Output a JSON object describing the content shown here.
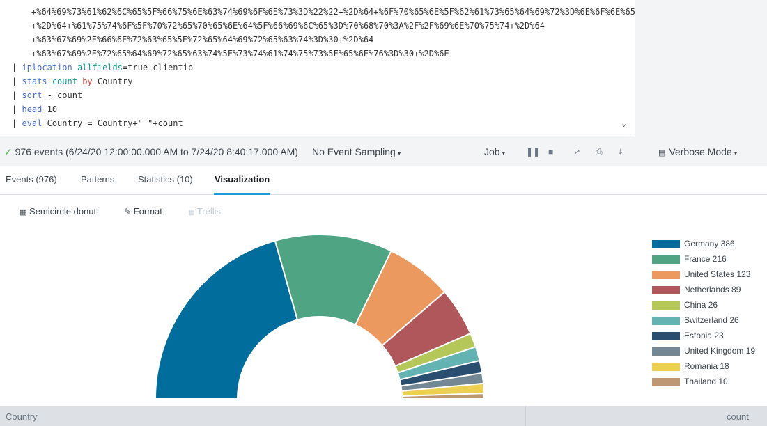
{
  "search": {
    "lines": [
      {
        "kind": "cont",
        "text": "+%64%69%73%61%62%6C%65%5F%66%75%6E%63%74%69%6F%6E%73%3D%22%22+%2D%64+%6F%70%65%6E%5F%62%61%73%65%64%69%72%3D%6E%6F%6E%65"
      },
      {
        "kind": "cont",
        "text": "+%2D%64+%61%75%74%6F%5F%70%72%65%70%65%6E%64%5F%66%69%6C%65%3D%70%68%70%3A%2F%2F%69%6E%70%75%74+%2D%64"
      },
      {
        "kind": "cont",
        "text": "+%63%67%69%2E%66%6F%72%63%65%5F%72%65%64%69%72%65%63%74%3D%30+%2D%64"
      },
      {
        "kind": "cont",
        "text": "+%63%67%69%2E%72%65%64%69%72%65%63%74%5F%73%74%61%74%75%73%5F%65%6E%76%3D%30+%2D%6E"
      },
      {
        "kind": "cmd",
        "pipe": "|",
        "cmd": "iplocation",
        "arg": "allfields",
        "rest": "=true clientip"
      },
      {
        "kind": "cmd",
        "pipe": "|",
        "cmd": "stats",
        "arg": "count",
        "by": "by",
        "rest": "Country"
      },
      {
        "kind": "cmd",
        "pipe": "|",
        "cmd": "sort",
        "rest": "- count"
      },
      {
        "kind": "cmd",
        "pipe": "|",
        "cmd": "head",
        "rest": "10"
      },
      {
        "kind": "cmd",
        "pipe": "|",
        "cmd": "eval",
        "rest": "Country = Country+\" \"+count"
      }
    ]
  },
  "status": {
    "check": "✓",
    "events_text": "976 events (6/24/20 12:00:00.000 AM to 7/24/20 8:40:17.000 AM)",
    "sampling": "No Event Sampling",
    "job": "Job",
    "mode": "Verbose Mode",
    "caret": "▾"
  },
  "tabs": [
    "Events (976)",
    "Patterns",
    "Statistics (10)",
    "Visualization"
  ],
  "active_tab": "Visualization",
  "viz_toolbar": {
    "chart_type": "Semicircle donut",
    "format": "Format",
    "trellis": "Trellis"
  },
  "chart_data": {
    "type": "pie",
    "variant": "semicircle-donut",
    "legend_position": "right",
    "categories": [
      "Germany 386",
      "France 216",
      "United States 123",
      "Netherlands 89",
      "China 26",
      "Switzerland 26",
      "Estonia 23",
      "United Kingdom 19",
      "Romania 18",
      "Thailand 10"
    ],
    "values": [
      386,
      216,
      123,
      89,
      26,
      26,
      23,
      19,
      18,
      10
    ],
    "colors": [
      "#006d9c",
      "#4fa484",
      "#ec9960",
      "#af575a",
      "#b6c75a",
      "#62b3b2",
      "#294e70",
      "#738795",
      "#edd051",
      "#bd9872"
    ]
  },
  "table": {
    "columns": [
      "Country",
      "count"
    ]
  }
}
